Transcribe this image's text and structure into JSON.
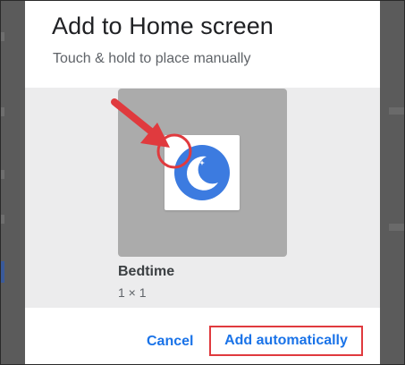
{
  "dialog": {
    "title": "Add to Home screen",
    "subtitle": "Touch & hold to place manually"
  },
  "widget": {
    "name": "Bedtime",
    "size": "1 × 1",
    "icon": "moon-icon"
  },
  "actions": {
    "cancel_label": "Cancel",
    "add_label": "Add automatically"
  },
  "colors": {
    "accent": "#1a73e8",
    "annotation": "#e03a3e",
    "icon_blue": "#3c7be0"
  }
}
